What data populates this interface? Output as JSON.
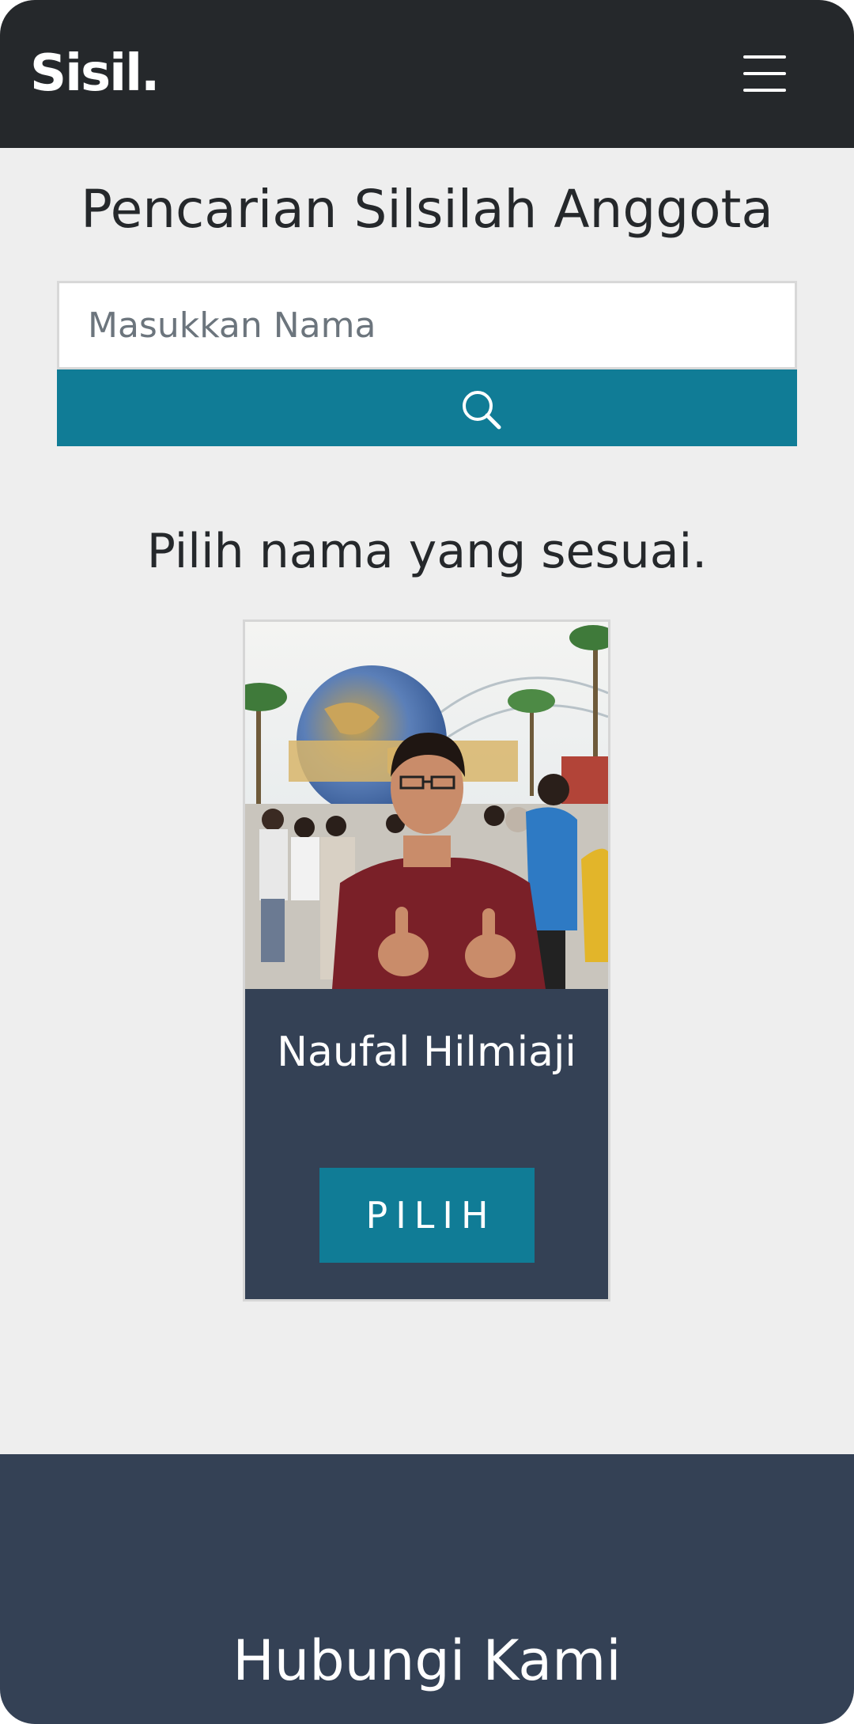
{
  "navbar": {
    "brand": "Sisil.",
    "menu_icon": "hamburger-menu-icon"
  },
  "search": {
    "title": "Pencarian Silsilah Anggota",
    "placeholder": "Masukkan Nama",
    "button_icon": "search-icon",
    "accent_color": "#107c96"
  },
  "results": {
    "subtitle": "Pilih nama yang sesuai.",
    "cards": [
      {
        "name": "Naufal Hilmiaji",
        "button_label": "PILIH"
      }
    ]
  },
  "footer": {
    "title": "Hubungi Kami",
    "background_color": "#344155"
  },
  "colors": {
    "navbar": "#25282b",
    "page_background": "#eeeeee",
    "card_background": "#344155",
    "primary": "#107c96"
  }
}
